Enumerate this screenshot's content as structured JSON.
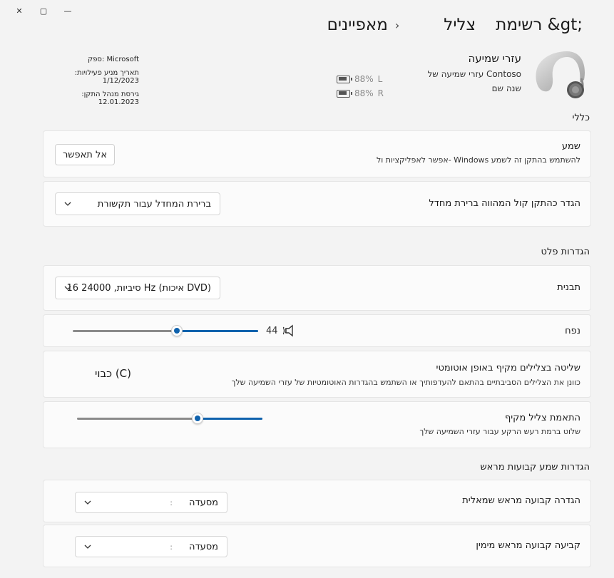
{
  "window": {
    "close_glyph": "✕",
    "maximize_glyph": "▢",
    "minimize_glyph": "—"
  },
  "breadcrumb": {
    "items": [
      "רשימת &gt;",
      "צליל",
      "מאפיינים"
    ],
    "separator": "›"
  },
  "device": {
    "name": "עזרי שמיעה",
    "manufacturer_line": "עזרי שמיעה של Contoso",
    "rename_link": "שנה שם",
    "icon": "hearing-aid-image"
  },
  "battery": {
    "left_label": "L",
    "left_value": "88%",
    "right_label": "R",
    "right_value": "88%"
  },
  "vendor": {
    "manufacturer": "ספק: Microsoft",
    "activation_date": "תאריך מניע פעילויות: 1/12/2023",
    "driver_version": "גירסת מנהל התקן: 12.01.2023"
  },
  "sections": {
    "general": "כללי",
    "pallet_settings": "הגדרות פלט",
    "audio_presets": "הגדרות שמע קבועות מראש"
  },
  "audio_card": {
    "title": "שמע",
    "description": "אפשר לאפליקציות ול- Windows להשתמש בהתקן זה לשמע",
    "button_label": "אל תאפשר"
  },
  "default_device_card": {
    "title": "הגדר כהתקן קול המהווה ברירת מחדל",
    "dropdown_value": "ברירת המחדל עבור תקשורת"
  },
  "format_card": {
    "title": "תבנית",
    "dropdown_value": "16 סיביות, 24000 Hz (איכות DVD)"
  },
  "volume_card": {
    "title": "נפח",
    "value": "44",
    "level_percent": 44,
    "icon": "speaker-icon"
  },
  "ambient_card": {
    "title": "שליטה בצלילים מקיף באופן אוטומטי",
    "description": "כוונן את הצלילים הסביבתיים בהתאם להעדפותיך או השתמש בהגדרות האוטומטיות של עזרי השמיעה שלך",
    "toggle_label": "כבוי (C)"
  },
  "ambient_slider_card": {
    "title": "התאמת צליל מקיף",
    "description": "שלוט ברמת רעש הרקע עבור עזרי השמיעה שלך",
    "level_percent": 35
  },
  "left_preset_card": {
    "title": "הגדרה קבועה מראש שמאלית",
    "dropdown_value": "מסעדה",
    "dropdown_sep": ":"
  },
  "right_preset_card": {
    "title": "קביעה קבועה מראש מימין",
    "dropdown_value": "מסעדה",
    "dropdown_sep": ":"
  },
  "colors": {
    "accent": "#0f62ad",
    "background": "#f3f3f3",
    "card": "#fbfbfb"
  }
}
